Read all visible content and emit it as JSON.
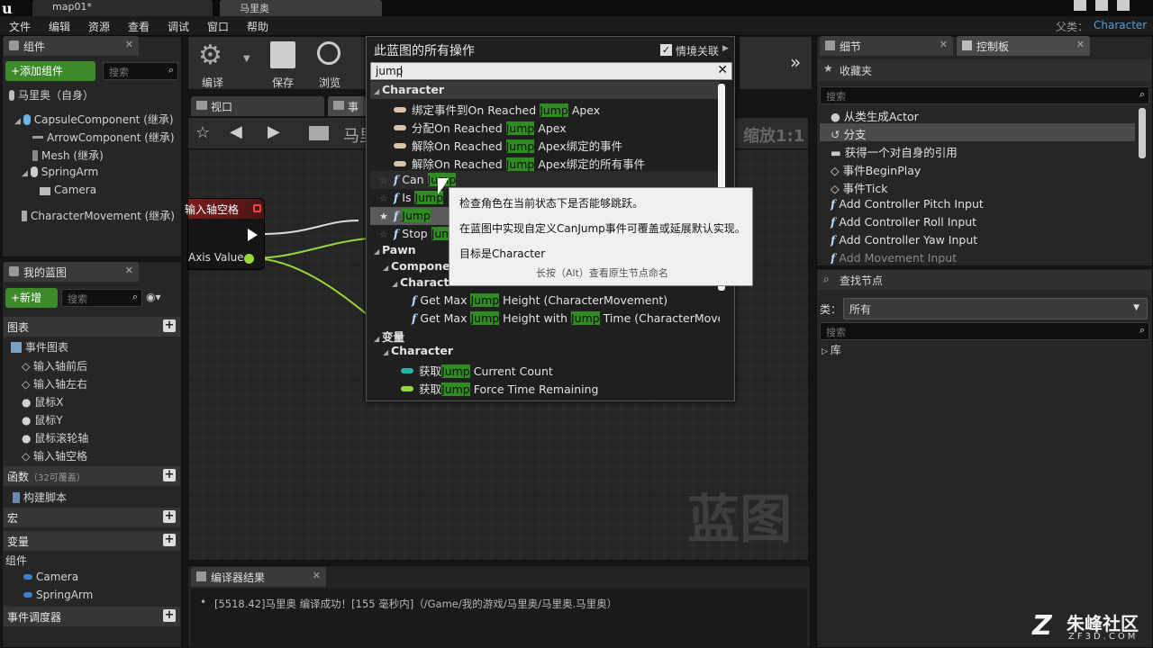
{
  "window": {
    "tabs": [
      "map01*",
      "马里奥"
    ],
    "parent_label": "父类：",
    "parent_value": "Character"
  },
  "menu": [
    "文件",
    "编辑",
    "资源",
    "查看",
    "调试",
    "窗口",
    "帮助"
  ],
  "components_panel": {
    "tab": "组件",
    "add_button": "+添加组件",
    "search_placeholder": "搜索",
    "items": [
      "马里奥（自身）",
      "CapsuleComponent (继承)",
      "ArrowComponent (继承)",
      "Mesh (继承)",
      "SpringArm",
      "Camera",
      "CharacterMovement (继承)"
    ]
  },
  "my_blueprint": {
    "tab": "我的蓝图",
    "new_button": "+新增",
    "search_placeholder": "搜索",
    "graphs_header": "图表",
    "event_graph": "事件图表",
    "events": [
      "输入轴前后",
      "输入轴左右",
      "鼠标X",
      "鼠标Y",
      "鼠标滚轮轴",
      "输入轴空格"
    ],
    "functions_header": "函数",
    "functions_count": "（32可覆盖）",
    "construct": "构建脚本",
    "macros_header": "宏",
    "variables_header": "变量",
    "components_cat": "组件",
    "vars": [
      "Camera",
      "SpringArm"
    ],
    "dispatchers_header": "事件调度器"
  },
  "toolbar": {
    "compile": "编译",
    "save": "保存",
    "browse": "浏览"
  },
  "graph": {
    "tab_viewport": "视口",
    "tab_event": "事件",
    "breadcrumb": "马里",
    "zoom": "缩放1:1",
    "node_title": "输入轴空格",
    "pin_label": "Axis Value",
    "watermark": "蓝图"
  },
  "popup": {
    "title": "此蓝图的所有操作",
    "context_label": "情境关联",
    "query": "jump",
    "rows": [
      {
        "kind": "cat",
        "pre": "Character",
        "hl": "",
        "post": ""
      },
      {
        "kind": "ev",
        "pre": "绑定事件到On Reached ",
        "hl": "Jump",
        "post": " Apex"
      },
      {
        "kind": "ev",
        "pre": "分配On Reached ",
        "hl": "Jump",
        "post": " Apex"
      },
      {
        "kind": "ev",
        "pre": "解除On Reached ",
        "hl": "Jump",
        "post": " Apex绑定的事件"
      },
      {
        "kind": "ev",
        "pre": "解除On Reached ",
        "hl": "Jump",
        "post": " Apex绑定的所有事件"
      },
      {
        "kind": "fn",
        "pre": "Can ",
        "hl": "Jump",
        "post": ""
      },
      {
        "kind": "fn",
        "pre": "Is ",
        "hl": "Jump",
        "post": ""
      },
      {
        "kind": "fn",
        "pre": "",
        "hl": "Jump",
        "post": ""
      },
      {
        "kind": "fn",
        "pre": "Stop ",
        "hl": "Jum",
        "post": ""
      },
      {
        "kind": "cat",
        "pre": "Pawn",
        "hl": "",
        "post": ""
      },
      {
        "kind": "cat2",
        "pre": "Components",
        "hl": "",
        "post": ""
      },
      {
        "kind": "cat3",
        "pre": "Character M",
        "hl": "",
        "post": ""
      },
      {
        "kind": "fn2",
        "pre": "Get Max ",
        "hl": "Jump",
        "post": " Height (CharacterMovement)"
      },
      {
        "kind": "fn3",
        "pre": "Get Max ",
        "hl": "Jump",
        "post": " Height with ",
        "hl2": "Jump",
        "post2": " Time (CharacterMove"
      },
      {
        "kind": "cat",
        "pre": "变量",
        "hl": "",
        "post": ""
      },
      {
        "kind": "cat2",
        "pre": "Character",
        "hl": "",
        "post": ""
      },
      {
        "kind": "var",
        "pre": "获取",
        "hl": "Jump",
        "post": " Current Count"
      },
      {
        "kind": "var",
        "pre": "获取",
        "hl": "Jump",
        "post": " Force Time Remaining"
      }
    ]
  },
  "tooltip": {
    "line1": "检查角色在当前状态下是否能够跳跃。",
    "line2": "在蓝图中实现自定义CanJump事件可覆盖或延展默认实现。",
    "line3": "目标是Character",
    "hint": "长按（Alt）查看原生节点命名"
  },
  "details_tab": "细节",
  "palette_tab": "控制板",
  "palette": {
    "favorites": "收藏夹",
    "search_placeholder": "搜索",
    "items": [
      "从类生成Actor",
      "分支",
      "获得一个对自身的引用",
      "事件BeginPlay",
      "事件Tick",
      "Add Controller Pitch Input",
      "Add Controller Roll Input",
      "Add Controller Yaw Input",
      "Add Movement Input"
    ],
    "find_nodes": "查找节点",
    "class_label": "类：",
    "class_value": "所有",
    "library": "库"
  },
  "compiler": {
    "tab": "编译器结果",
    "message": "[5518.42]马里奥 编译成功！[155 毫秒内]（/Game/我的游戏/马里奥/马里奥.马里奥）"
  },
  "brand": {
    "name": "朱峰社区",
    "domain": "ZF3D.COM"
  }
}
